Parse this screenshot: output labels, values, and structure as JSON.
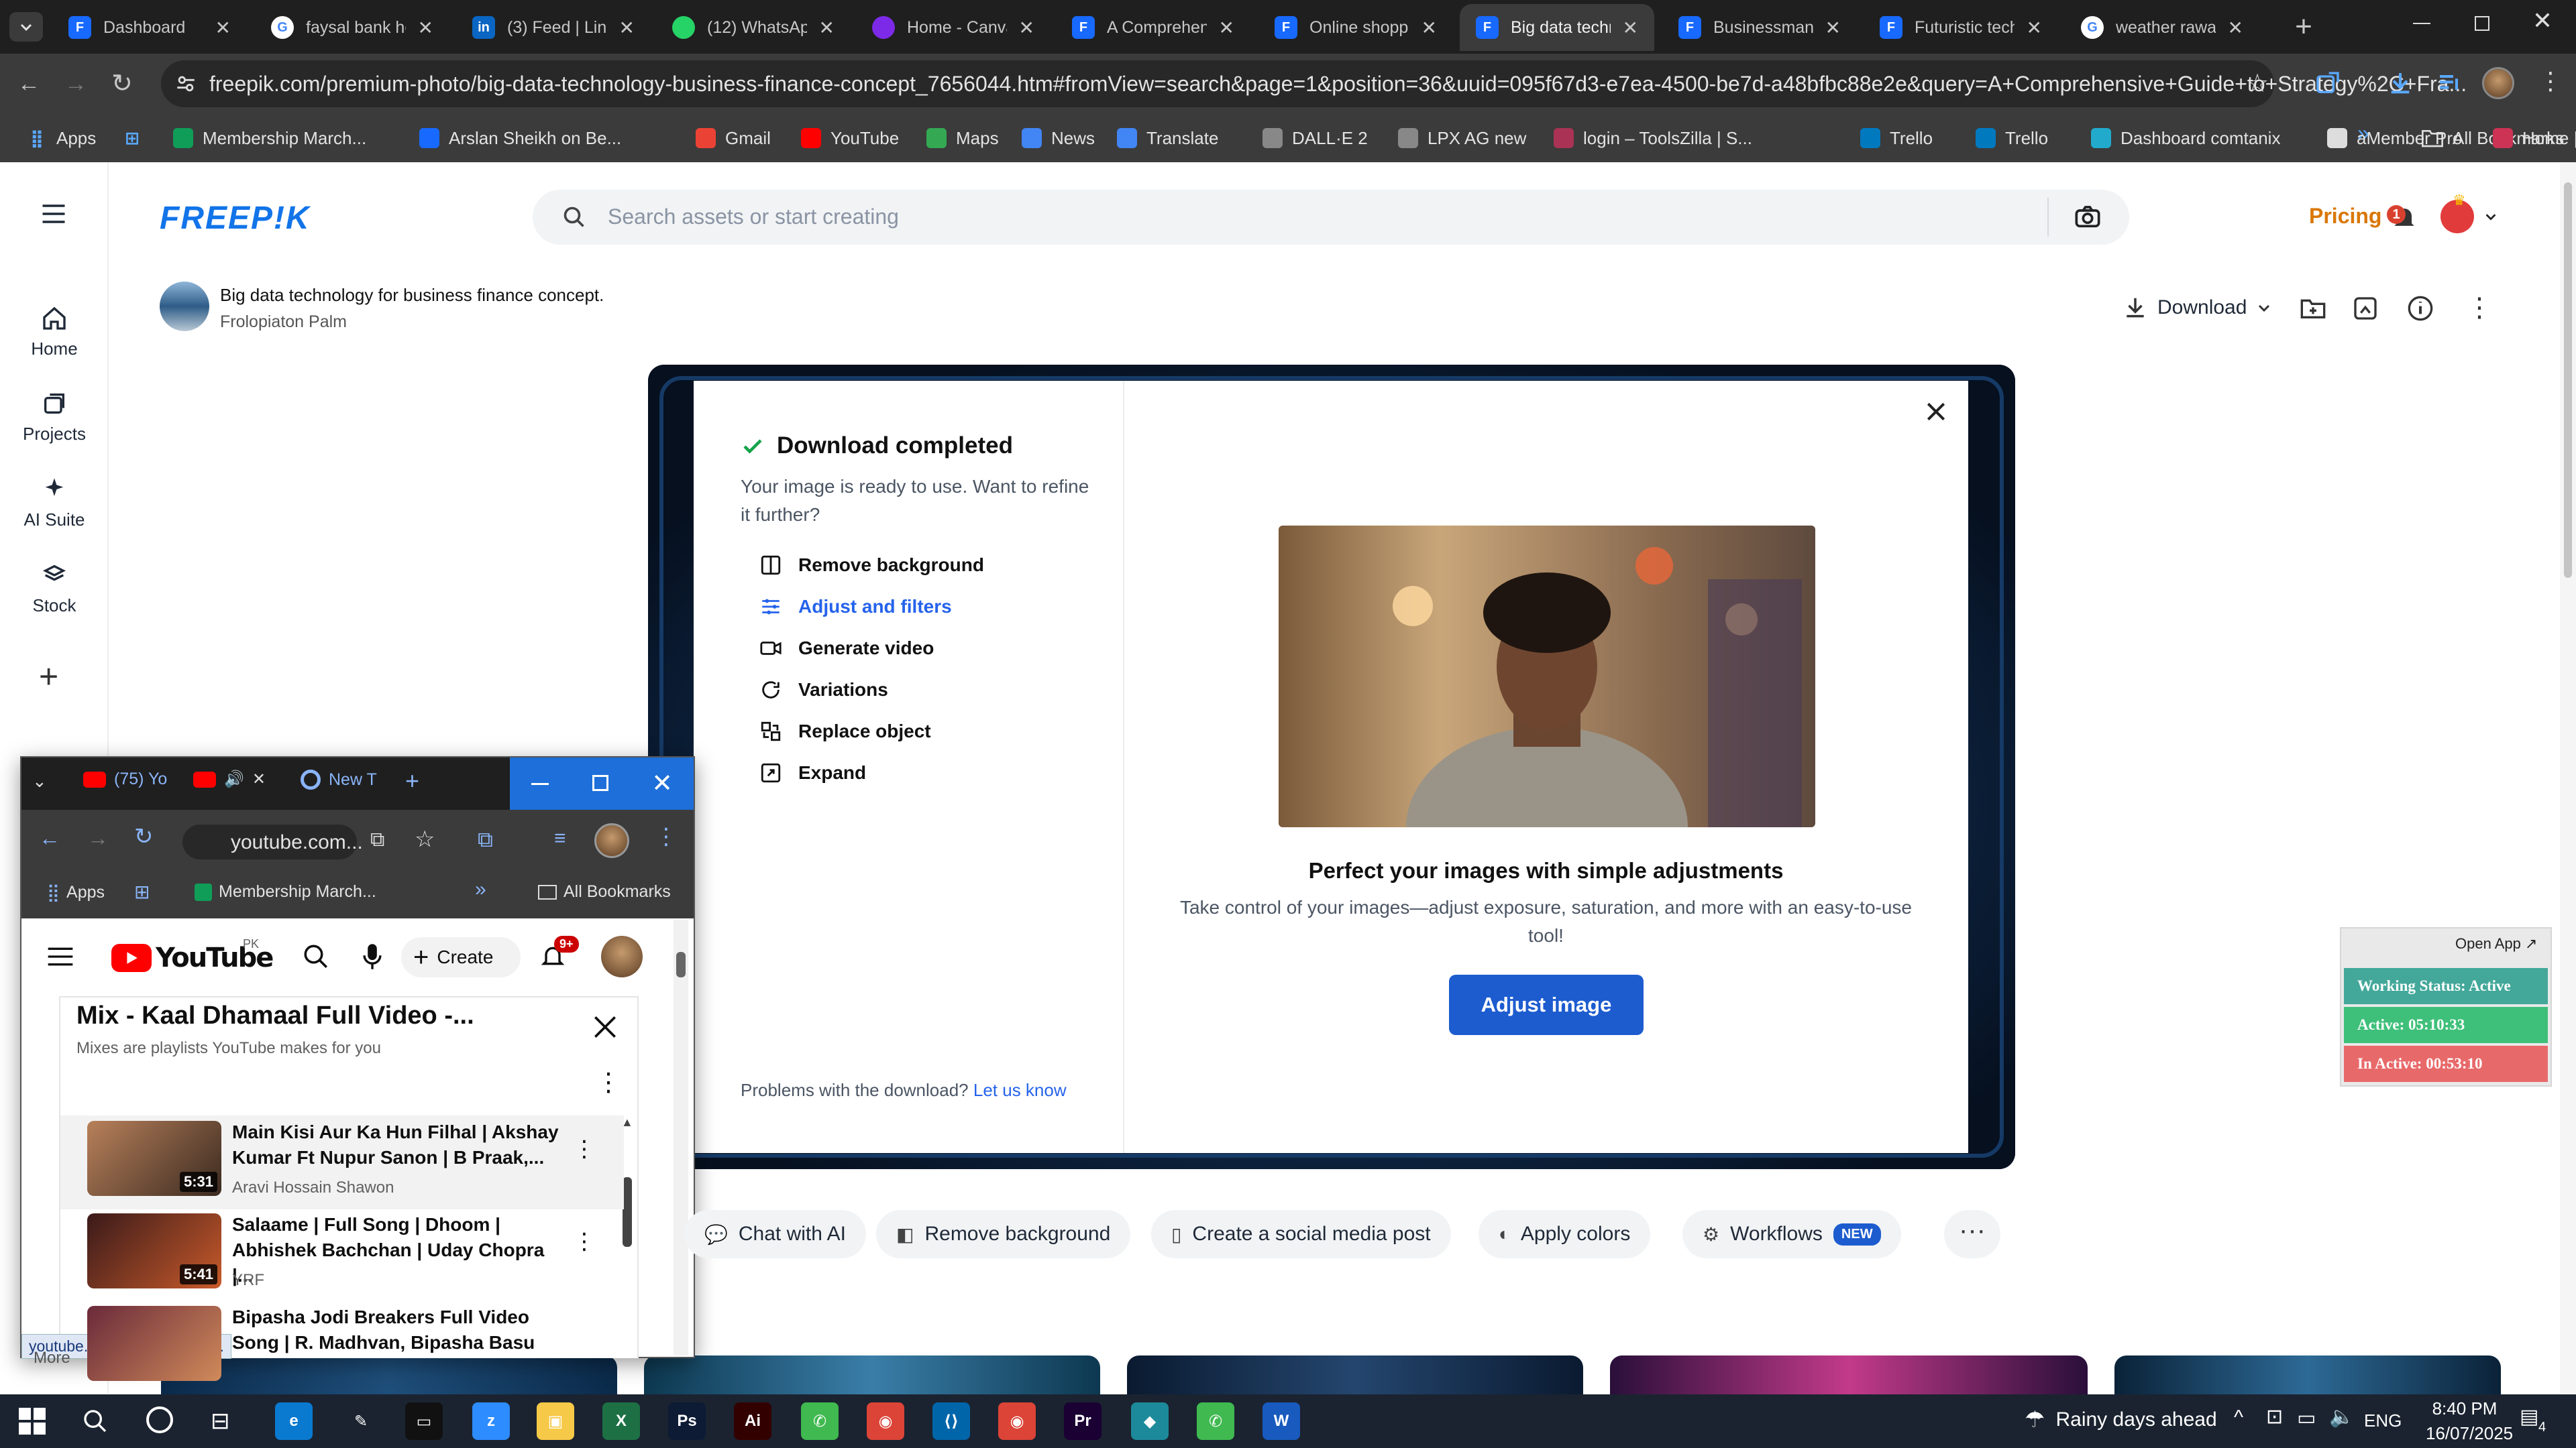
{
  "browser": {
    "tabs": [
      {
        "title": "Dashboard",
        "icon": "freepik-doc-icon",
        "color": "#4d7cff"
      },
      {
        "title": "faysal bank he",
        "icon": "google-icon",
        "color": "#ffffff"
      },
      {
        "title": "(3) Feed | Linke",
        "icon": "linkedin-icon",
        "color": "#0a66c2"
      },
      {
        "title": "(12) WhatsApp",
        "icon": "whatsapp-icon",
        "color": "#25d366"
      },
      {
        "title": "Home - Canva",
        "icon": "canva-icon",
        "color": "#7d2ae8"
      },
      {
        "title": "A Comprehens",
        "icon": "doc-icon",
        "color": "#4d7cff"
      },
      {
        "title": "Online shoppin",
        "icon": "doc-icon",
        "color": "#4d7cff"
      },
      {
        "title": "Big data techn",
        "icon": "doc-icon",
        "color": "#4d7cff",
        "active": true
      },
      {
        "title": "Businessman w",
        "icon": "doc-icon",
        "color": "#4d7cff"
      },
      {
        "title": "Futuristic tech",
        "icon": "doc-icon",
        "color": "#4d7cff"
      },
      {
        "title": "weather rawalp",
        "icon": "google-icon",
        "color": "#ffffff"
      }
    ],
    "url": "freepik.com/premium-photo/big-data-technology-business-finance-concept_7656044.htm#fromView=search&page=1&position=36&uuid=095f67d3-e7ea-4500-be7d-a48bfbc88e2e&query=A+Comprehensive+Guide+to+Strategy%2C+Fra...",
    "bookmarks": [
      {
        "label": "Apps",
        "color": "#4d7cff"
      },
      {
        "label": "",
        "color": "#4d7cff"
      },
      {
        "label": "Membership March...",
        "color": "#0f9d58"
      },
      {
        "label": "Arslan Sheikh on Be...",
        "color": "#1769ff"
      },
      {
        "label": "Gmail",
        "color": "#ea4335"
      },
      {
        "label": "YouTube",
        "color": "#ff0000"
      },
      {
        "label": "Maps",
        "color": "#34a853"
      },
      {
        "label": "News",
        "color": "#4285f4"
      },
      {
        "label": "Translate",
        "color": "#4285f4"
      },
      {
        "label": "DALL·E 2",
        "color": "#888888"
      },
      {
        "label": "LPX AG new",
        "color": "#888888"
      },
      {
        "label": "login – ToolsZilla | S...",
        "color": "#aa3355"
      },
      {
        "label": "Trello",
        "color": "#0079bf"
      },
      {
        "label": "Trello",
        "color": "#0079bf"
      },
      {
        "label": "Dashboard comtanix",
        "color": "#22aacc"
      },
      {
        "label": "aMember Pro",
        "color": "#dddddd"
      },
      {
        "label": "Home | PixVerse",
        "color": "#cc3355"
      }
    ],
    "all_bookmarks": "All Bookmarks"
  },
  "freepik": {
    "logo": "FREEP!K",
    "search_placeholder": "Search assets or start creating",
    "pricing": "Pricing",
    "notification_count": "1",
    "nav": [
      {
        "label": "Home",
        "icon": "home-icon"
      },
      {
        "label": "Projects",
        "icon": "projects-icon"
      },
      {
        "label": "AI Suite",
        "icon": "sparkle-icon"
      },
      {
        "label": "Stock",
        "icon": "stock-icon"
      }
    ],
    "asset_title": "Big data technology for business finance concept.",
    "asset_author": "Frolopiaton Palm",
    "download_label": "Download",
    "modal": {
      "title": "Download completed",
      "subtitle": "Your image is ready to use. Want to refine it further?",
      "options": [
        {
          "label": "Remove background",
          "icon": "remove-bg-icon"
        },
        {
          "label": "Adjust and filters",
          "icon": "sliders-icon",
          "selected": true
        },
        {
          "label": "Generate video",
          "icon": "video-icon"
        },
        {
          "label": "Variations",
          "icon": "refresh-icon"
        },
        {
          "label": "Replace object",
          "icon": "replace-icon"
        },
        {
          "label": "Expand",
          "icon": "expand-icon"
        }
      ],
      "problem_text": "Problems with the download?",
      "problem_link": "Let us know",
      "promo_title": "Perfect your images with simple adjustments",
      "promo_text": "Take control of your images—adjust exposure, saturation, and more with an easy-to-use tool!",
      "cta": "Adjust image"
    },
    "actions": [
      {
        "label": "Chat with AI",
        "icon": "chat-icon"
      },
      {
        "label": "Remove background",
        "icon": "remove-bg-icon"
      },
      {
        "label": "Create a social media post",
        "icon": "phone-icon"
      },
      {
        "label": "Apply colors",
        "icon": "palette-icon"
      },
      {
        "label": "Workflows",
        "icon": "workflow-icon",
        "badge": "NEW"
      }
    ]
  },
  "widget": {
    "open_app": "Open App ↗",
    "status": "Working Status: Active",
    "active": "Active: 05:10:33",
    "inactive": "In Active: 00:53:10",
    "colors": {
      "status": "#43a89a",
      "active": "#3fc07a",
      "inactive": "#e8696a"
    }
  },
  "youtube_window": {
    "tabs": [
      {
        "title": "(75) Yo"
      },
      {
        "title": ""
      },
      {
        "title": "New T"
      }
    ],
    "url": "youtube.com...",
    "bookmarks": [
      "Apps",
      "Membership March...",
      "All Bookmarks"
    ],
    "country": "PK",
    "create": "Create",
    "notif_count": "9+",
    "mix_title": "Mix - Kaal Dhamaal Full Video -...",
    "mix_subtitle": "Mixes are playlists YouTube makes for you",
    "videos": [
      {
        "title": "Main Kisi Aur Ka Hun Filhal | Akshay Kumar Ft Nupur Sanon | B Praak,...",
        "channel": "Aravi Hossain Shawon",
        "duration": "5:31"
      },
      {
        "title": "Salaame | Full Song | Dhoom | Abhishek Bachchan | Uday Chopra |...",
        "channel": "YRF",
        "duration": "5:41"
      },
      {
        "title": "Bipasha Jodi Breakers Full Video Song | R. Madhvan, Bipasha Basu",
        "channel": "",
        "duration": ""
      }
    ],
    "status_url": "youtube.com/watch?v=gJs...",
    "more": "More"
  },
  "taskbar": {
    "weather": "Rainy days ahead",
    "lang": "ENG",
    "time": "8:40 PM",
    "date": "16/07/2025",
    "notif": "4"
  }
}
